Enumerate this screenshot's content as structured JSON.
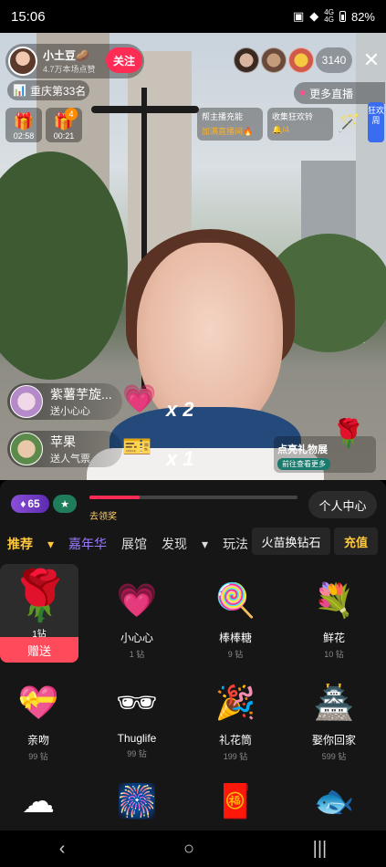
{
  "status": {
    "time": "15:06",
    "battery": "82%",
    "net1": "4G",
    "net2": "4G"
  },
  "host": {
    "name": "小土豆🥔",
    "sub": "4.7万本场点赞",
    "follow": "关注"
  },
  "room": {
    "viewer_count": "3140",
    "close": "✕",
    "rank": "重庆第33名",
    "more_live": "更多直播"
  },
  "boxes": [
    {
      "time": "02:58"
    },
    {
      "time": "00:21",
      "badge": "4"
    }
  ],
  "tasks": [
    {
      "l1": "帮主播充能",
      "l2": "加满直播间🔥"
    },
    {
      "l1": "收集狂欢铃",
      "l2": "🔔/4"
    }
  ],
  "side_badge": "狂欢周",
  "gifters": [
    {
      "name": "紫薯芋旋...",
      "desc": "送小心心",
      "combo": "x 2"
    },
    {
      "name": "苹果",
      "desc": "送人气票",
      "combo": "x 1"
    }
  ],
  "promo": {
    "title": "点亮礼物展",
    "sub": "前往查看更多"
  },
  "panel": {
    "level": "65",
    "fan": "★",
    "go_claim": "去领奖",
    "personal": "个人中心",
    "swap": "火苗换钻石",
    "recharge": "充值",
    "progress": 0.24
  },
  "tabs": [
    "推荐",
    "嘉年华",
    "展馆",
    "发现",
    "玩法"
  ],
  "gifts": [
    {
      "name": "",
      "price": "1钻",
      "icon": "🌹",
      "send": "赠送"
    },
    {
      "name": "小心心",
      "price": "1 钻",
      "icon": "💗"
    },
    {
      "name": "棒棒糖",
      "price": "9 钻",
      "icon": "🍭"
    },
    {
      "name": "鲜花",
      "price": "10 钻",
      "icon": "💐"
    },
    {
      "name": "亲吻",
      "price": "99 钻",
      "icon": "💝"
    },
    {
      "name": "Thuglife",
      "price": "99 钻",
      "icon": "🕶"
    },
    {
      "name": "礼花筒",
      "price": "199 钻",
      "icon": "🎉"
    },
    {
      "name": "娶你回家",
      "price": "599 钻",
      "icon": "🏯"
    },
    {
      "name": "",
      "price": "",
      "icon": "☁"
    },
    {
      "name": "",
      "price": "",
      "icon": "🎆"
    },
    {
      "name": "",
      "price": "",
      "icon": "🧧"
    },
    {
      "name": "",
      "price": "",
      "icon": "🐟"
    }
  ],
  "nav": {
    "back": "‹",
    "home": "○",
    "recent": "|||"
  }
}
